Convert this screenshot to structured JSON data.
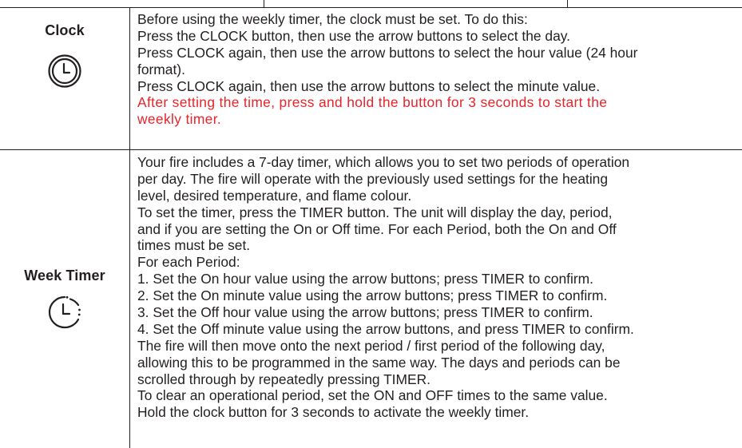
{
  "rows": [
    {
      "label": "Clock",
      "icon": "clock-icon",
      "lines": [
        "Before using the weekly timer, the clock must be set.  To do this:",
        "Press the CLOCK button, then use the arrow buttons to select the day.",
        "Press CLOCK again, then use the arrow buttons to select the hour value (24 hour",
        "format).",
        "Press CLOCK again, then use the arrow buttons to select the minute value."
      ],
      "warning_lines": [
        "After setting the time, press and hold the button for 3 seconds to start the",
        "weekly timer."
      ],
      "warning_color": "#e8232a"
    },
    {
      "label": "Week Timer",
      "icon": "timer-icon",
      "lines": [
        "Your fire includes a 7-day timer, which allows you to set two periods of operation",
        "per day. The fire will operate with the previously used settings for the heating",
        "level, desired temperature, and flame colour.",
        "To set the timer, press the TIMER button. The unit will display the day, period,",
        "and if you are setting the On or Off time. For each Period, both the On and Off",
        "times must be set.",
        "For each Period:",
        "1. Set the On hour value using the arrow buttons; press TIMER to confirm.",
        "2. Set the On minute value using the arrow buttons; press TIMER to confirm.",
        "3. Set the Off hour value using the arrow buttons; press TIMER to confirm.",
        "4. Set the Off minute value using the arrow buttons, and press TIMER to confirm.",
        "The fire will then move onto the next period / first period of the following day,",
        "allowing this to be programmed in the same way. The days and periods can be",
        "scrolled through by repeatedly pressing TIMER.",
        "To clear an operational period, set the ON and OFF times to the same value.",
        "Hold the clock button for 3 seconds to activate the weekly timer."
      ]
    }
  ]
}
